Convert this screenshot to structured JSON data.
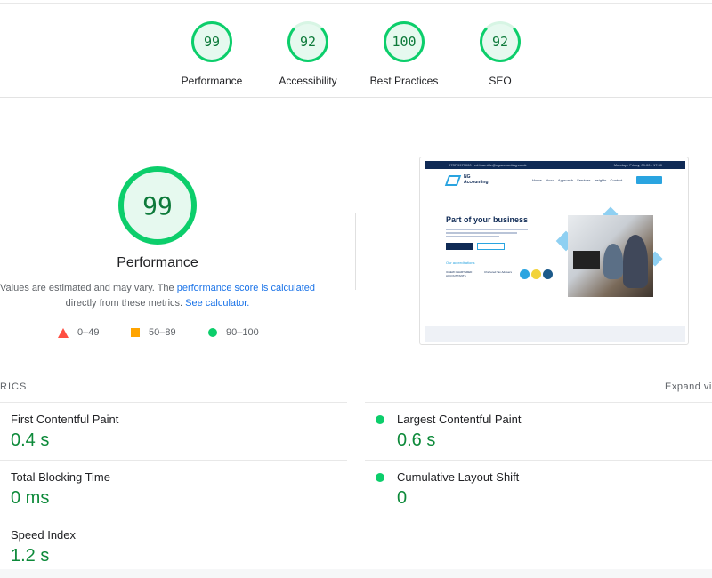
{
  "summary": {
    "gauges": [
      {
        "score": "99",
        "label": "Performance"
      },
      {
        "score": "92",
        "label": "Accessibility"
      },
      {
        "score": "100",
        "label": "Best Practices"
      },
      {
        "score": "92",
        "label": "SEO"
      }
    ]
  },
  "performance": {
    "score": "99",
    "title": "Performance",
    "note_prefix": "Values are estimated and may vary. The ",
    "note_link": "performance score is calculated",
    "note_middle": "directly from these metrics.",
    "calc_link": "See calculator.",
    "legend": [
      {
        "range": "0–49",
        "shape": "triangle",
        "color": "#ff4e42"
      },
      {
        "range": "50–89",
        "shape": "square",
        "color": "#ffa400"
      },
      {
        "range": "90–100",
        "shape": "circle",
        "color": "#0cce6b"
      }
    ]
  },
  "screenshot": {
    "phone": "0737 9979000",
    "email": "ed.bramble@ngaccounting.co.uk",
    "hours": "Monday - Friday, 09:00 - 17:30",
    "brand_line1": "NG",
    "brand_line2": "Accounting",
    "nav": "Home About Approach Services Insights Contact",
    "headline": "Part of your business",
    "accreditations": "Our accreditations",
    "icaew": "ICAEW CHARTERED ACCOUNTANTS",
    "ciot": "Chartered Tax Advisers"
  },
  "metrics": {
    "header_left": "RICS",
    "header_right": "Expand vi",
    "items": [
      {
        "label": "First Contentful Paint",
        "value": "0.4 s"
      },
      {
        "label": "Largest Contentful Paint",
        "value": "0.6 s"
      },
      {
        "label": "Total Blocking Time",
        "value": "0 ms"
      },
      {
        "label": "Cumulative Layout Shift",
        "value": "0"
      },
      {
        "label": "Speed Index",
        "value": "1.2 s"
      }
    ]
  },
  "colors": {
    "pass": "#0cce6b",
    "average": "#ffa400",
    "fail": "#ff4e42",
    "link": "#1a73e8",
    "metric_value": "#0d8a3a"
  }
}
